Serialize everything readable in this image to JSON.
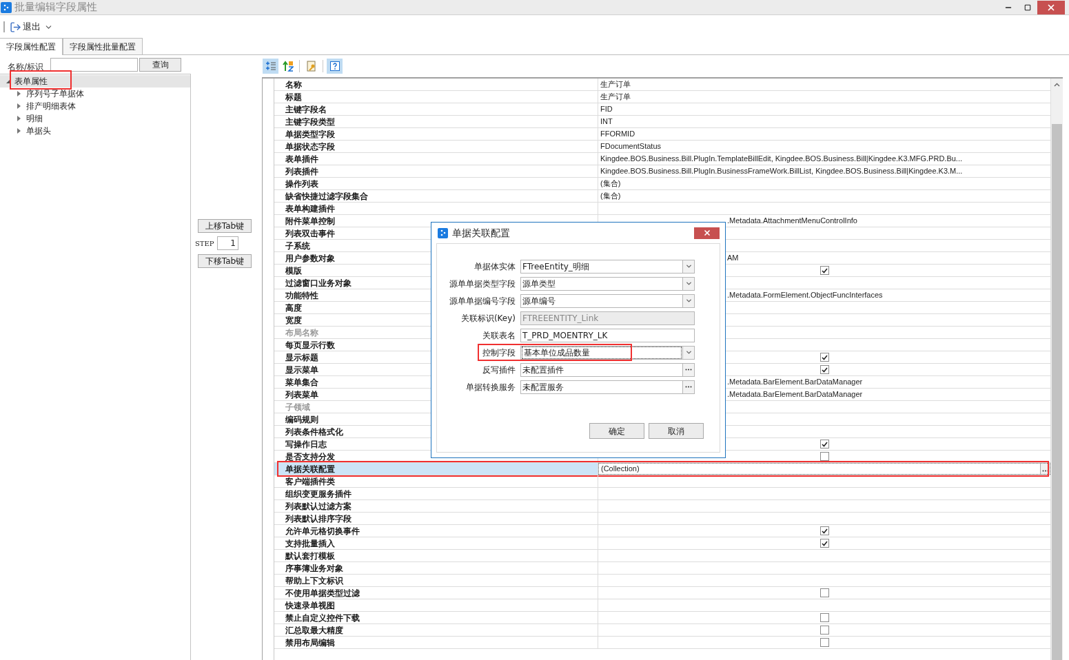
{
  "window": {
    "title": "批量编辑字段属性"
  },
  "toolbar": {
    "exit_label": "退出"
  },
  "tabs": [
    {
      "label": "字段属性配置",
      "selected": true
    },
    {
      "label": "字段属性批量配置",
      "selected": false
    }
  ],
  "search": {
    "label": "名称/标识",
    "button": "查询"
  },
  "tree": {
    "items": [
      {
        "label": "表单属性",
        "expanded": true,
        "selected": true,
        "children": [
          {
            "label": "序列号子单据体",
            "expanded": false,
            "selected": false
          },
          {
            "label": "排产明细表体",
            "expanded": false,
            "selected": false
          },
          {
            "label": "明细",
            "expanded": false,
            "selected": false
          },
          {
            "label": "单据头",
            "expanded": false,
            "selected": false
          }
        ]
      }
    ]
  },
  "tab_order": {
    "up_button": "上移Tab键",
    "step_label": "STEP",
    "step_value": "1",
    "down_button": "下移Tab键"
  },
  "grid_toolbar": [
    {
      "kind": "categorized",
      "selected": true
    },
    {
      "kind": "alphabetical",
      "selected": false
    },
    {
      "kind": "property_pages",
      "selected": false
    },
    {
      "kind": "help",
      "selected": true
    }
  ],
  "properties": [
    {
      "name": "名称",
      "kind": "text",
      "value": "生产订单",
      "disabled": false,
      "selected": false
    },
    {
      "name": "标题",
      "kind": "text",
      "value": "生产订单",
      "disabled": false,
      "selected": false
    },
    {
      "name": "主键字段名",
      "kind": "text",
      "value": "FID",
      "disabled": false,
      "selected": false
    },
    {
      "name": "主键字段类型",
      "kind": "text",
      "value": "INT",
      "disabled": false,
      "selected": false
    },
    {
      "name": "单据类型字段",
      "kind": "text",
      "value": "FFORMID",
      "disabled": false,
      "selected": false
    },
    {
      "name": "单据状态字段",
      "kind": "text",
      "value": "FDocumentStatus",
      "disabled": false,
      "selected": false
    },
    {
      "name": "表单插件",
      "kind": "text",
      "value": "Kingdee.BOS.Business.Bill.PlugIn.TemplateBillEdit, Kingdee.BOS.Business.Bill|Kingdee.K3.MFG.PRD.Bu...",
      "disabled": false,
      "selected": false
    },
    {
      "name": "列表插件",
      "kind": "text",
      "value": "Kingdee.BOS.Business.Bill.PlugIn.BusinessFrameWork.BillList, Kingdee.BOS.Business.Bill|Kingdee.K3.M...",
      "disabled": false,
      "selected": false
    },
    {
      "name": "操作列表",
      "kind": "text",
      "value": "(集合)",
      "disabled": false,
      "selected": false
    },
    {
      "name": "缺省快捷过滤字段集合",
      "kind": "text",
      "value": "(集合)",
      "disabled": false,
      "selected": false
    },
    {
      "name": "表单构建插件",
      "kind": "text",
      "disabled": false,
      "selected": false
    },
    {
      "name": "附件菜单控制",
      "kind": "covered",
      "value": ".Metadata.AttachmentMenuControlInfo",
      "disabled": false,
      "selected": false
    },
    {
      "name": "列表双击事件",
      "kind": "text",
      "disabled": false,
      "selected": false
    },
    {
      "name": "子系统",
      "kind": "text",
      "disabled": false,
      "selected": false
    },
    {
      "name": "用户参数对象",
      "kind": "covered",
      "value": "AM",
      "disabled": false,
      "selected": false
    },
    {
      "name": "模版",
      "kind": "checkbox",
      "checked": true,
      "disabled": false,
      "selected": false
    },
    {
      "name": "过滤窗口业务对象",
      "kind": "text",
      "disabled": false,
      "selected": false
    },
    {
      "name": "功能特性",
      "kind": "covered",
      "value": ".Metadata.FormElement.ObjectFuncInterfaces",
      "disabled": false,
      "selected": false
    },
    {
      "name": "高度",
      "kind": "text",
      "disabled": false,
      "selected": false
    },
    {
      "name": "宽度",
      "kind": "text",
      "disabled": false,
      "selected": false
    },
    {
      "name": "布局名称",
      "kind": "text",
      "disabled": true,
      "selected": false
    },
    {
      "name": "每页显示行数",
      "kind": "text",
      "disabled": false,
      "selected": false
    },
    {
      "name": "显示标题",
      "kind": "checkbox",
      "checked": true,
      "disabled": false,
      "selected": false
    },
    {
      "name": "显示菜单",
      "kind": "checkbox",
      "checked": true,
      "disabled": false,
      "selected": false
    },
    {
      "name": "菜单集合",
      "kind": "covered",
      "value": ".Metadata.BarElement.BarDataManager",
      "disabled": false,
      "selected": false
    },
    {
      "name": "列表菜单",
      "kind": "covered",
      "value": ".Metadata.BarElement.BarDataManager",
      "disabled": false,
      "selected": false
    },
    {
      "name": "子领域",
      "kind": "text",
      "disabled": true,
      "selected": false
    },
    {
      "name": "编码规则",
      "kind": "text",
      "disabled": false,
      "selected": false
    },
    {
      "name": "列表条件格式化",
      "kind": "text",
      "disabled": false,
      "selected": false
    },
    {
      "name": "写操作日志",
      "kind": "checkbox",
      "checked": true,
      "disabled": false,
      "selected": false
    },
    {
      "name": "是否支持分发",
      "kind": "checkbox",
      "checked": false,
      "disabled": false,
      "selected": false
    },
    {
      "name": "单据关联配置",
      "kind": "text",
      "value": "(Collection)",
      "disabled": false,
      "selected": true
    },
    {
      "name": "客户端插件类",
      "kind": "text",
      "disabled": false,
      "selected": false
    },
    {
      "name": "组织变更服务插件",
      "kind": "text",
      "disabled": false,
      "selected": false
    },
    {
      "name": "列表默认过滤方案",
      "kind": "text",
      "disabled": false,
      "selected": false
    },
    {
      "name": "列表默认排序字段",
      "kind": "text",
      "disabled": false,
      "selected": false
    },
    {
      "name": "允许单元格切换事件",
      "kind": "checkbox",
      "checked": true,
      "disabled": false,
      "selected": false
    },
    {
      "name": "支持批量插入",
      "kind": "checkbox",
      "checked": true,
      "disabled": false,
      "selected": false
    },
    {
      "name": "默认套打模板",
      "kind": "text",
      "disabled": false,
      "selected": false
    },
    {
      "name": "序事簿业务对象",
      "kind": "text",
      "disabled": false,
      "selected": false
    },
    {
      "name": "帮助上下文标识",
      "kind": "text",
      "disabled": false,
      "selected": false
    },
    {
      "name": "不使用单据类型过滤",
      "kind": "checkbox",
      "checked": false,
      "disabled": false,
      "selected": false
    },
    {
      "name": "快速录单视图",
      "kind": "text",
      "disabled": false,
      "selected": false
    },
    {
      "name": "禁止自定义控件下载",
      "kind": "checkbox",
      "checked": false,
      "disabled": false,
      "selected": false
    },
    {
      "name": "汇总取最大精度",
      "kind": "checkbox",
      "checked": false,
      "disabled": false,
      "selected": false
    },
    {
      "name": "禁用布局编辑",
      "kind": "checkbox",
      "checked": false,
      "disabled": false,
      "selected": false
    }
  ],
  "dialog": {
    "title": "单据关联配置",
    "fields": [
      {
        "label": "单据体实体",
        "kind": "dropdown",
        "value": "FTreeEntity_明细",
        "focused": false
      },
      {
        "label": "源单单据类型字段",
        "kind": "dropdown",
        "value": "源单类型",
        "focused": false
      },
      {
        "label": "源单单据编号字段",
        "kind": "dropdown",
        "value": "源单编号",
        "focused": false
      },
      {
        "label": "关联标识(Key)",
        "kind": "readonly",
        "value": "FTREEENTITY_Link",
        "focused": false
      },
      {
        "label": "关联表名",
        "kind": "text",
        "value": "T_PRD_MOENTRY_LK",
        "focused": false
      },
      {
        "label": "控制字段",
        "kind": "dropdown",
        "value": "基本单位成品数量",
        "focused": true
      },
      {
        "label": "反写插件",
        "kind": "picker",
        "value": "未配置插件",
        "focused": false
      },
      {
        "label": "单据转换服务",
        "kind": "picker",
        "value": "未配置服务",
        "focused": false
      }
    ],
    "buttons": [
      "确定",
      "取消"
    ]
  }
}
